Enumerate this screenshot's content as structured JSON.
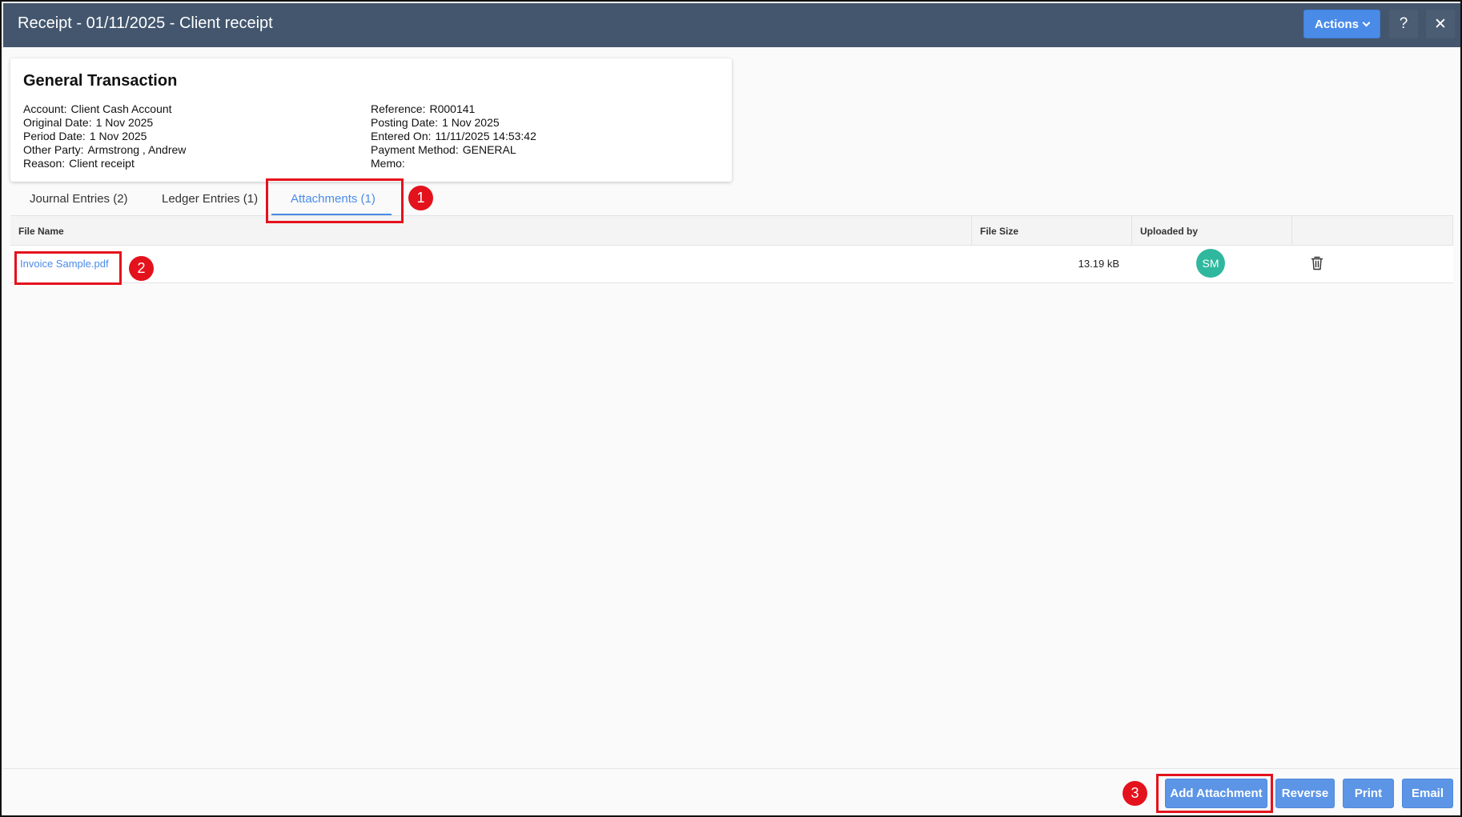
{
  "window": {
    "title": "Receipt - 01/11/2025 - Client receipt",
    "actions_label": "Actions",
    "help_label": "?",
    "close_label": "✕"
  },
  "summary": {
    "title": "General Transaction",
    "left": [
      {
        "label": "Account:",
        "value": "Client Cash Account"
      },
      {
        "label": "Original Date:",
        "value": "1 Nov 2025"
      },
      {
        "label": "Period Date:",
        "value": "1 Nov 2025"
      },
      {
        "label": "Other Party:",
        "value": "Armstrong , Andrew"
      },
      {
        "label": "Reason:",
        "value": "Client receipt"
      }
    ],
    "right": [
      {
        "label": "Reference:",
        "value": "R000141"
      },
      {
        "label": "Posting Date:",
        "value": "1 Nov 2025"
      },
      {
        "label": "Entered On:",
        "value": "11/11/2025 14:53:42"
      },
      {
        "label": "Payment Method:",
        "value": "GENERAL"
      },
      {
        "label": "Memo:",
        "value": ""
      }
    ]
  },
  "tabs": [
    {
      "label": "Journal Entries (2)",
      "active": false
    },
    {
      "label": "Ledger Entries (1)",
      "active": false
    },
    {
      "label": "Attachments (1)",
      "active": true
    }
  ],
  "attachments_table": {
    "columns": [
      "File Name",
      "File Size",
      "Uploaded by",
      ""
    ],
    "rows": [
      {
        "file_name": "Invoice Sample.pdf",
        "file_size": "13.19 kB",
        "uploaded_by": "SM",
        "delete_icon": "trash-icon"
      }
    ]
  },
  "footer_buttons": {
    "add_attachment": "Add Attachment",
    "reverse": "Reverse",
    "print": "Print",
    "email": "Email"
  },
  "callouts": [
    "1",
    "2",
    "3"
  ],
  "colors": {
    "titlebar": "#43566e",
    "accent": "#4a8be8",
    "button": "#5c95e6",
    "avatar": "#2fb89e",
    "callout": "#e4121c"
  }
}
